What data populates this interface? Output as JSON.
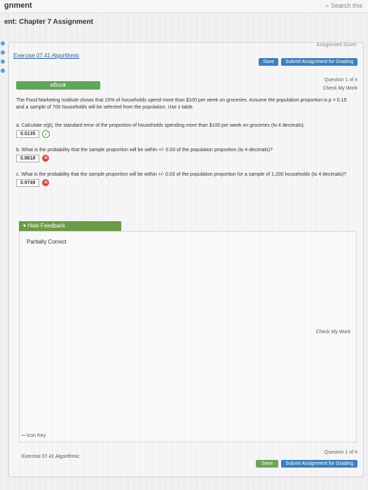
{
  "topbar": {
    "title": "gnment",
    "search": "Search this"
  },
  "header": {
    "subtitle": "ent: Chapter 7 Assignment"
  },
  "right_top": {
    "line1": "Assignment Score:",
    "line2": "Save",
    "line3": "Submit Assignment for Grading"
  },
  "exercise_title": "Exercise 07.41 Algorithmic",
  "question_nav": "Question 1 of 4",
  "check_work": "Check My Work",
  "ebook_label": "eBook",
  "question_text": "The Food Marketing Institute shows that 15% of households spend more than $100 per week on groceries. Assume the population proportion is p = 0.15 and a sample of 700 households will be selected from the population. Use z-table.",
  "parts": [
    {
      "label": "a. Calculate σ(p̄), the standard error of the proportion of households spending more than $100 per week on groceries (to 4 decimals).",
      "answer": "0.0135",
      "status": "ok"
    },
    {
      "label": "b. What is the probability that the sample proportion will be within +/- 0.03 of the population proportion (to 4 decimals)?",
      "answer": "0.8618",
      "status": "bad"
    },
    {
      "label": "c. What is the probability that the sample proportion will be within +/- 0.03 of the population proportion for a sample of 1,200 households (to 4 decimals)?",
      "answer": "0.9749",
      "status": "bad"
    }
  ],
  "feedback": {
    "hide_label": "Hide Feedback",
    "status": "Partially Correct",
    "check_work": "Check My Work",
    "learn_key": "Icon Key"
  },
  "footer": {
    "exercise": "Exercise 07.41 Algorithmic",
    "nav": "Question 1 of 4",
    "save": "Save",
    "submit": "Submit Assignment for Grading"
  },
  "colors": {
    "accent_blue": "#3c7fbf",
    "green": "#6aa55a",
    "error": "#d64a3a"
  }
}
